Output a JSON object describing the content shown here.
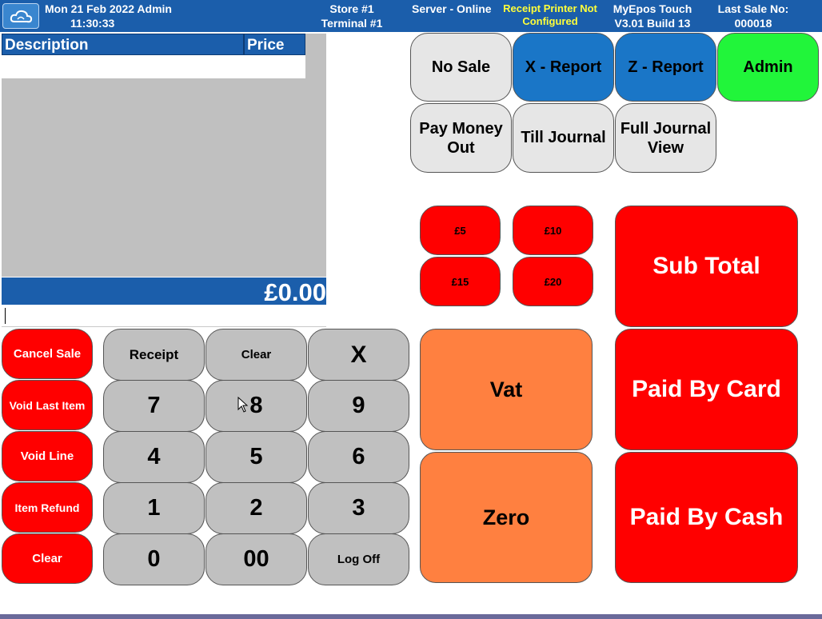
{
  "header": {
    "datetime_line": "Mon 21 Feb 2022 Admin",
    "time": "11:30:33",
    "store": "Store #1",
    "terminal": "Terminal #1",
    "server_status": "Server - Online",
    "printer_status": "Receipt Printer Not Configured",
    "app_name": "MyEpos Touch",
    "version": "V3.01 Build 13",
    "last_sale_label": "Last Sale No:",
    "last_sale_no": "000018"
  },
  "ticket": {
    "col_description": "Description",
    "col_price": "Price",
    "total": "£0.00"
  },
  "actions": {
    "cancel_sale": "Cancel Sale",
    "void_last_item": "Void Last Item",
    "void_line": "Void Line",
    "item_refund": "Item Refund",
    "clear": "Clear"
  },
  "keypad": {
    "receipt": "Receipt",
    "clear": "Clear",
    "times": "X",
    "k7": "7",
    "k8": "8",
    "k9": "9",
    "k4": "4",
    "k5": "5",
    "k6": "6",
    "k1": "1",
    "k2": "2",
    "k3": "3",
    "k0": "0",
    "k00": "00",
    "log_off": "Log Off"
  },
  "functions": {
    "no_sale": "No Sale",
    "x_report": "X - Report",
    "z_report": "Z - Report",
    "admin": "Admin",
    "pay_money_out": "Pay Money Out",
    "till_journal": "Till Journal",
    "full_journal": "Full Journal View"
  },
  "quick_cash": {
    "five": "£5",
    "ten": "£10",
    "fifteen": "£15",
    "twenty": "£20"
  },
  "tax": {
    "vat": "Vat",
    "zero": "Zero"
  },
  "payment": {
    "sub_total": "Sub Total",
    "paid_by_card": "Paid By Card",
    "paid_by_cash": "Paid By Cash"
  },
  "colors": {
    "header_blue": "#1b5eab",
    "button_blue": "#1a76c7",
    "admin_green": "#21f53a",
    "action_red": "#ff0000",
    "tax_orange": "#ff8040",
    "key_grey": "#c0c0c0",
    "printer_warning_yellow": "#ffff3a"
  },
  "icons": {
    "logo": "cloud-icon",
    "cursor": "mouse-pointer-icon"
  }
}
